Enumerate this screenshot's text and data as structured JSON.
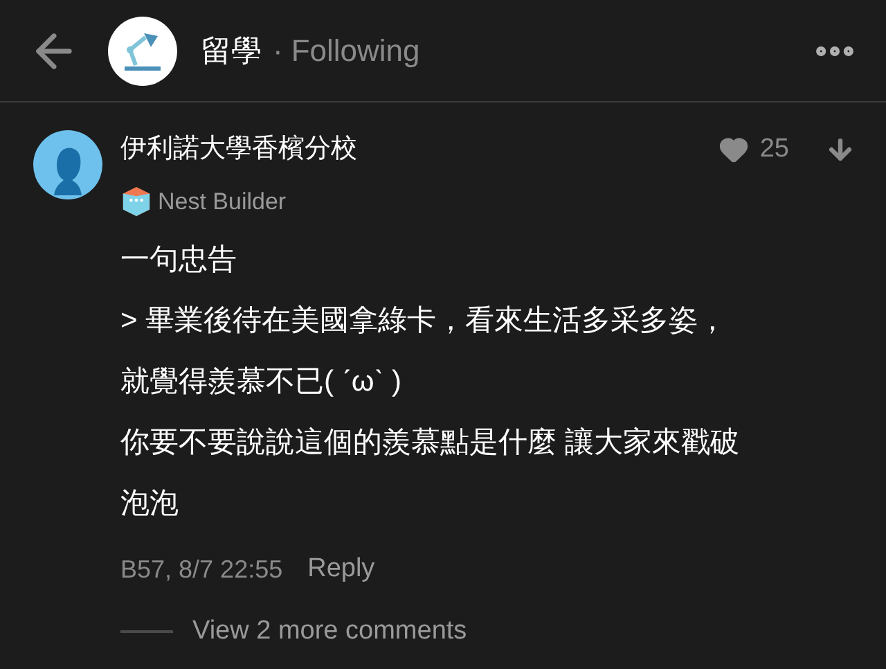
{
  "header": {
    "title": "留學",
    "separator": "·",
    "status": "Following"
  },
  "comment": {
    "author": "伊利諾大學香檳分校",
    "badge": "Nest Builder",
    "likes": "25",
    "liked": false,
    "lines": [
      "一句忠告",
      "> 畢業後待在美國拿綠卡，看來生活多采多姿，",
      "就覺得羨慕不已( ˊωˋ )",
      "你要不要說說這個的羨慕點是什麼 讓大家來戳破",
      "泡泡"
    ],
    "meta": "B57, 8/7 22:55",
    "reply": "Reply",
    "more": "View 2 more comments"
  }
}
